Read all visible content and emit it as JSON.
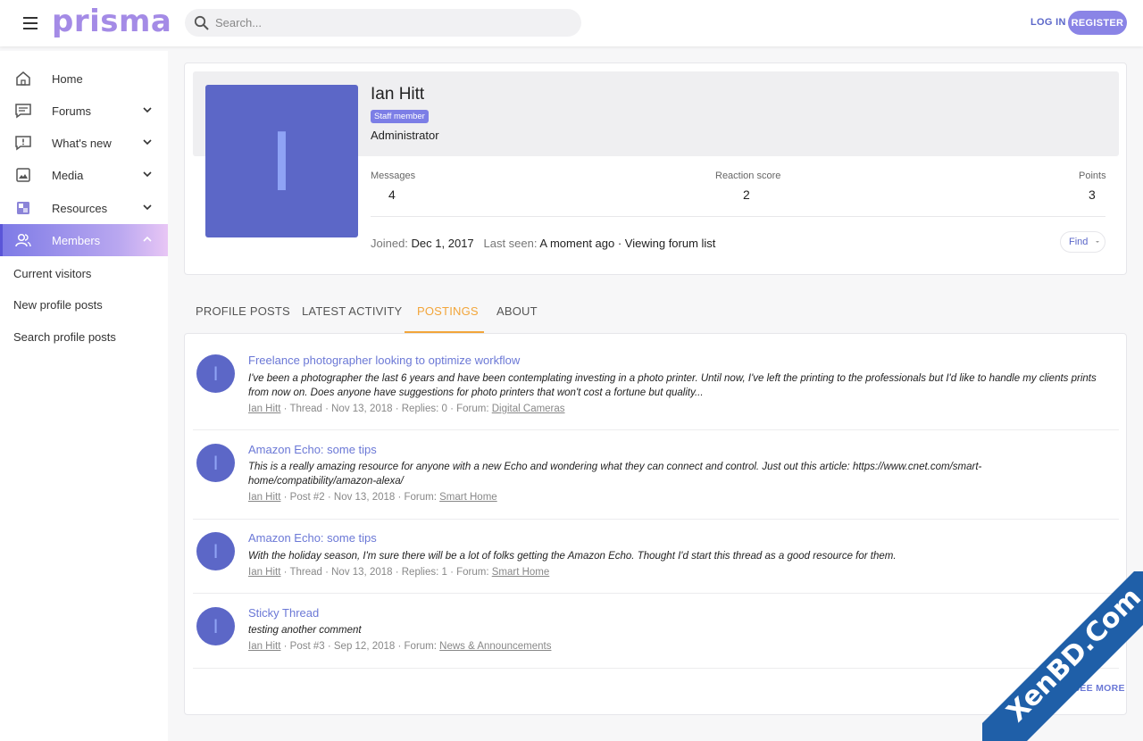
{
  "header": {
    "logo": "prisma",
    "search_placeholder": "Search...",
    "login_label": "LOG IN",
    "register_label": "REGISTER"
  },
  "sidebar": {
    "items": [
      {
        "label": "Home",
        "icon": "home-icon"
      },
      {
        "label": "Forums",
        "icon": "forums-icon",
        "expandable": true
      },
      {
        "label": "What's new",
        "icon": "whats-new-icon",
        "expandable": true
      },
      {
        "label": "Media",
        "icon": "media-icon",
        "expandable": true
      },
      {
        "label": "Resources",
        "icon": "resources-icon",
        "expandable": true
      },
      {
        "label": "Members",
        "icon": "members-icon",
        "expandable": true,
        "active": true
      }
    ],
    "subitems": [
      "Current visitors",
      "New profile posts",
      "Search profile posts"
    ]
  },
  "profile": {
    "avatar_letter": "I",
    "name": "Ian Hitt",
    "badge": "Staff member",
    "title": "Administrator",
    "stats": [
      {
        "label": "Messages",
        "value": "4"
      },
      {
        "label": "Reaction score",
        "value": "2"
      },
      {
        "label": "Points",
        "value": "3"
      }
    ],
    "joined_label": "Joined:",
    "joined_value": "Dec 1, 2017",
    "last_seen_label": "Last seen:",
    "last_seen_value": "A moment ago · Viewing forum list",
    "find_label": "Find"
  },
  "tabs": [
    {
      "label": "PROFILE POSTS"
    },
    {
      "label": "LATEST ACTIVITY"
    },
    {
      "label": "POSTINGS",
      "active": true
    },
    {
      "label": "ABOUT"
    }
  ],
  "posts": [
    {
      "avatar_letter": "I",
      "title": "Freelance photographer looking to optimize workflow",
      "snippet": "I've been a photographer the last 6 years and have been contemplating investing in a photo printer. Until now, I've left the printing to the professionals but I'd like to handle my clients prints from now on. Does anyone have suggestions for photo printers that won't cost a fortune but quality...",
      "author": "Ian Hitt",
      "meta": "· Thread · Nov 13, 2018 · Replies: 0 · Forum:",
      "forum": "Digital Cameras"
    },
    {
      "avatar_letter": "I",
      "title": "Amazon Echo: some tips",
      "snippet": "This is a really amazing resource for anyone with a new Echo and wondering what they can connect and control. Just out this article: https://www.cnet.com/smart-home/compatibility/amazon-alexa/",
      "author": "Ian Hitt",
      "meta": "· Post #2 · Nov 13, 2018 · Forum:",
      "forum": "Smart Home"
    },
    {
      "avatar_letter": "I",
      "title": "Amazon Echo: some tips",
      "snippet": "With the holiday season, I'm sure there will be a lot of folks getting the Amazon Echo. Thought I'd start this thread as a good resource for them.",
      "author": "Ian Hitt",
      "meta": "· Thread · Nov 13, 2018 · Replies: 1 · Forum:",
      "forum": "Smart Home"
    },
    {
      "avatar_letter": "I",
      "title": "Sticky Thread",
      "snippet": "testing another comment",
      "author": "Ian Hitt",
      "meta": "· Post #3 · Sep 12, 2018 · Forum:",
      "forum": "News & Announcements"
    }
  ],
  "see_more_label": "SEE MORE",
  "watermark": "XenBD.Com",
  "colors": {
    "accent": "#5b67c9",
    "avatar": "#5c67c7",
    "active_tab": "#f2a53a",
    "logo": "#a48be6",
    "watermark": "#1f5fa8"
  }
}
